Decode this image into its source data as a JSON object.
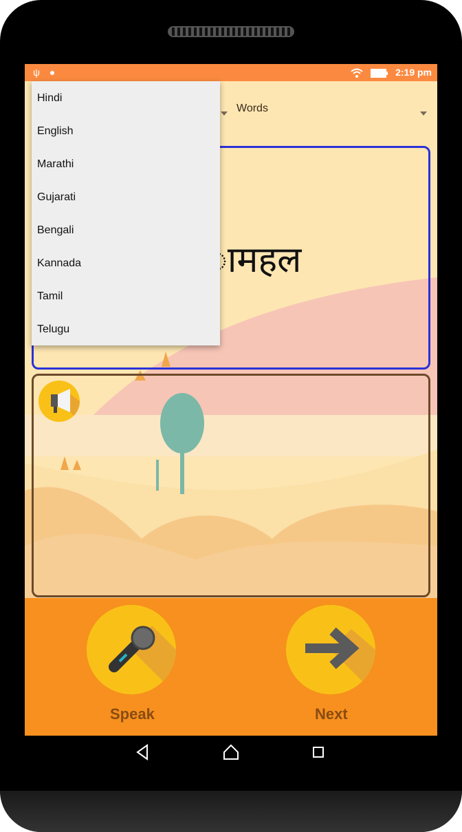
{
  "status_bar": {
    "time": "2:19 pm"
  },
  "controls": {
    "category_spinner": {
      "selected": "Words"
    }
  },
  "language_dropdown": {
    "options": [
      "Hindi",
      "English",
      "Marathi",
      "Gujarati",
      "Bengali",
      "Kannada",
      "Tamil",
      "Telugu"
    ]
  },
  "word_card": {
    "visible_word": "ामहल"
  },
  "buttons": {
    "speak_label": "Speak",
    "next_label": "Next"
  },
  "icons": {
    "speaker": "megaphone-icon",
    "speak": "microphone-icon",
    "next": "arrow-right-icon",
    "status_left": [
      "usb-icon",
      "android-icon"
    ],
    "status_right": [
      "wifi-icon",
      "battery-icon"
    ],
    "nav": [
      "back-icon",
      "home-icon",
      "recents-icon"
    ]
  },
  "colors": {
    "status_bar": "#fb8a40",
    "app_bg_top": "#fde6b2",
    "app_bg_bottom": "#f7901e",
    "word_card_border": "#2a31d8",
    "image_card_border": "#6b4a2a",
    "round_button": "#f9c118",
    "button_label": "#8a4b12"
  }
}
